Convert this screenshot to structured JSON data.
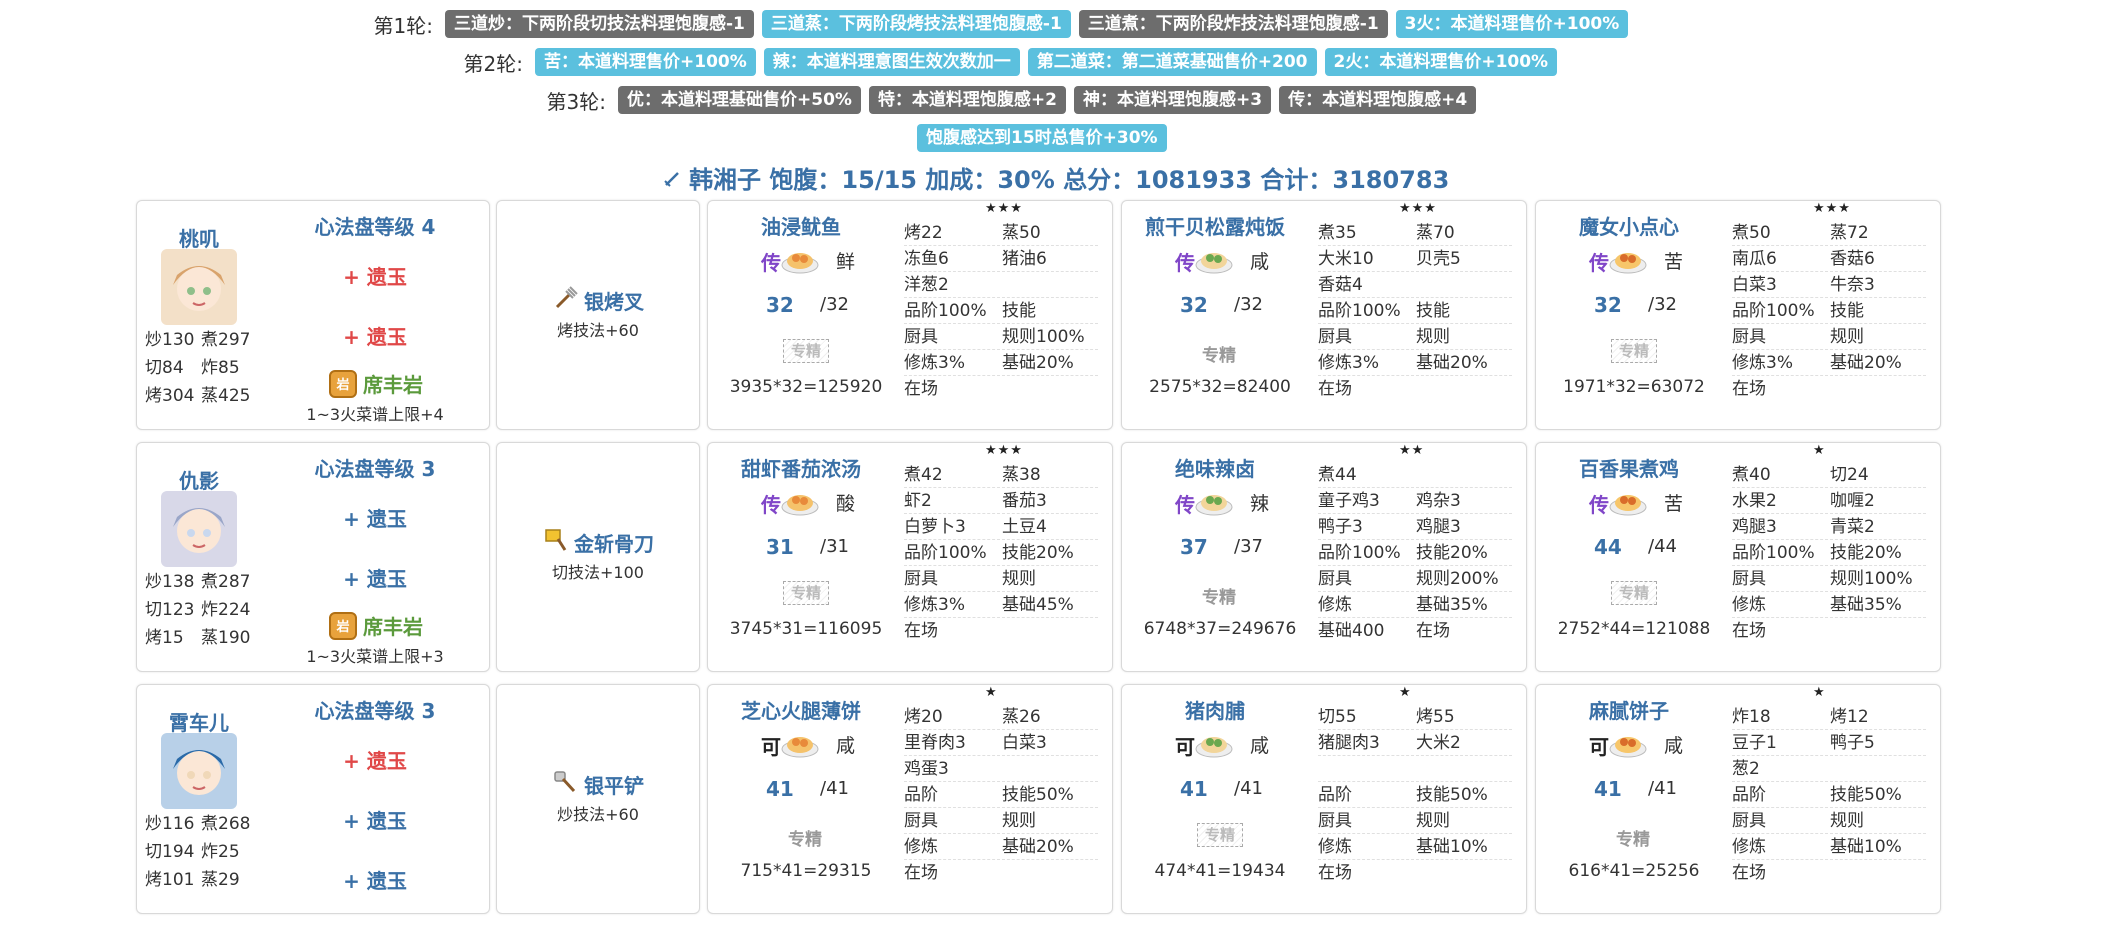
{
  "rounds": [
    {
      "label": "第1轮:",
      "tags": [
        {
          "text": "三道炒：下两阶段切技法料理饱腹感-1",
          "color": "gray"
        },
        {
          "text": "三道蒸：下两阶段烤技法料理饱腹感-1",
          "color": "blue"
        },
        {
          "text": "三道煮：下两阶段炸技法料理饱腹感-1",
          "color": "gray"
        },
        {
          "text": "3火：本道料理售价+100%",
          "color": "blue"
        }
      ]
    },
    {
      "label": "第2轮:",
      "tags": [
        {
          "text": "苦：本道料理售价+100%",
          "color": "blue"
        },
        {
          "text": "辣：本道料理意图生效次数加一",
          "color": "blue"
        },
        {
          "text": "第二道菜：第二道菜基础售价+200",
          "color": "blue"
        },
        {
          "text": "2火：本道料理售价+100%",
          "color": "blue"
        }
      ]
    },
    {
      "label": "第3轮:",
      "tags": [
        {
          "text": "优：本道料理基础售价+50%",
          "color": "gray"
        },
        {
          "text": "特：本道料理饱腹感+2",
          "color": "gray"
        },
        {
          "text": "神：本道料理饱腹感+3",
          "color": "gray"
        },
        {
          "text": "传：本道料理饱腹感+4",
          "color": "gray"
        }
      ]
    },
    {
      "label": "",
      "tags": [
        {
          "text": "饱腹感达到15时总售价+30%",
          "color": "blue"
        }
      ]
    }
  ],
  "summary": {
    "icon": "sword-icon",
    "text": "韩湘子 饱腹：15/15 加成：30% 总分：1081933 合计：3180783"
  },
  "colors": {
    "accent": "#3a70a6",
    "tag_gray": "#6d6d6d",
    "tag_blue": "#5bc0de",
    "red": "#e04848",
    "green": "#5b9a3c",
    "purple": "#8046c8"
  },
  "rows": [
    {
      "chef": {
        "name": "桃叽",
        "heart_level": "心法盘等级 4",
        "remains": [
          {
            "text": "+ 遗玉",
            "color": "red"
          },
          {
            "text": "+ 遗玉",
            "color": "red"
          }
        ],
        "partner": "席丰岩",
        "partner_skill": "1~3火菜谱上限+4",
        "stats": [
          [
            "炒130",
            "煮297"
          ],
          [
            "切84",
            "炸85"
          ],
          [
            "烤304",
            "蒸425"
          ]
        ]
      },
      "equip": {
        "name": "银烤叉",
        "skill": "烤技法+60",
        "icon": "fork-icon"
      },
      "dishes": [
        {
          "name": "油浸鱿鱼",
          "stars": "★★★",
          "rarity": "传",
          "rarity_color": "purple",
          "flavor": "鲜",
          "qty": "32",
          "max": "/32",
          "spec": "专精",
          "spec_style": "box",
          "score": "3935*32=125920",
          "cells": [
            [
              "烤22",
              "蒸50"
            ],
            [
              "冻鱼6",
              "猪油6"
            ],
            [
              "洋葱2",
              ""
            ],
            [
              "品阶100%",
              "技能"
            ],
            [
              "厨具",
              "规则100%"
            ],
            [
              "修炼3%",
              "基础20%"
            ],
            [
              "在场",
              ""
            ]
          ]
        },
        {
          "name": "煎干贝松露炖饭",
          "stars": "★★★",
          "rarity": "传",
          "rarity_color": "purple",
          "flavor": "咸",
          "qty": "32",
          "max": "/32",
          "spec": "专精",
          "spec_style": "text",
          "score": "2575*32=82400",
          "cells": [
            [
              "煮35",
              "蒸70"
            ],
            [
              "大米10",
              "贝壳5"
            ],
            [
              "香菇4",
              ""
            ],
            [
              "品阶100%",
              "技能"
            ],
            [
              "厨具",
              "规则"
            ],
            [
              "修炼3%",
              "基础20%"
            ],
            [
              "在场",
              ""
            ]
          ]
        },
        {
          "name": "魔女小点心",
          "stars": "★★★",
          "rarity": "传",
          "rarity_color": "purple",
          "flavor": "苦",
          "qty": "32",
          "max": "/32",
          "spec": "专精",
          "spec_style": "box",
          "score": "1971*32=63072",
          "cells": [
            [
              "煮50",
              "蒸72"
            ],
            [
              "南瓜6",
              "香菇6"
            ],
            [
              "白菜3",
              "牛奈3"
            ],
            [
              "品阶100%",
              "技能"
            ],
            [
              "厨具",
              "规则"
            ],
            [
              "修炼3%",
              "基础20%"
            ],
            [
              "在场",
              ""
            ]
          ]
        }
      ]
    },
    {
      "chef": {
        "name": "仇影",
        "heart_level": "心法盘等级 3",
        "remains": [
          {
            "text": "+ 遗玉",
            "color": "blue"
          },
          {
            "text": "+ 遗玉",
            "color": "blue"
          }
        ],
        "partner": "席丰岩",
        "partner_skill": "1~3火菜谱上限+3",
        "stats": [
          [
            "炒138",
            "煮287"
          ],
          [
            "切123",
            "炸224"
          ],
          [
            "烤15",
            "蒸190"
          ]
        ]
      },
      "equip": {
        "name": "金斩骨刀",
        "skill": "切技法+100",
        "icon": "cleaver-icon"
      },
      "dishes": [
        {
          "name": "甜虾番茄浓汤",
          "stars": "★★★",
          "rarity": "传",
          "rarity_color": "purple",
          "flavor": "酸",
          "qty": "31",
          "max": "/31",
          "spec": "专精",
          "spec_style": "box",
          "score": "3745*31=116095",
          "cells": [
            [
              "煮42",
              "蒸38"
            ],
            [
              "虾2",
              "番茄3"
            ],
            [
              "白萝卜3",
              "土豆4"
            ],
            [
              "品阶100%",
              "技能20%"
            ],
            [
              "厨具",
              "规则"
            ],
            [
              "修炼3%",
              "基础45%"
            ],
            [
              "在场",
              ""
            ]
          ]
        },
        {
          "name": "绝味辣卤",
          "stars": "★★",
          "rarity": "传",
          "rarity_color": "purple",
          "flavor": "辣",
          "qty": "37",
          "max": "/37",
          "spec": "专精",
          "spec_style": "text",
          "score": "6748*37=249676",
          "cells": [
            [
              "煮44",
              ""
            ],
            [
              "童子鸡3",
              "鸡杂3"
            ],
            [
              "鸭子3",
              "鸡腿3"
            ],
            [
              "品阶100%",
              "技能20%"
            ],
            [
              "厨具",
              "规则200%"
            ],
            [
              "修炼",
              "基础35%"
            ],
            [
              "基础400",
              "在场"
            ]
          ]
        },
        {
          "name": "百香果煮鸡",
          "stars": "★",
          "rarity": "传",
          "rarity_color": "purple",
          "flavor": "苦",
          "qty": "44",
          "max": "/44",
          "spec": "专精",
          "spec_style": "box",
          "score": "2752*44=121088",
          "cells": [
            [
              "煮40",
              "切24"
            ],
            [
              "水果2",
              "咖喱2"
            ],
            [
              "鸡腿3",
              "青菜2"
            ],
            [
              "品阶100%",
              "技能20%"
            ],
            [
              "厨具",
              "规则100%"
            ],
            [
              "修炼",
              "基础35%"
            ],
            [
              "在场",
              ""
            ]
          ]
        }
      ]
    },
    {
      "chef": {
        "name": "霄车儿",
        "heart_level": "心法盘等级 3",
        "remains": [
          {
            "text": "+ 遗玉",
            "color": "red"
          },
          {
            "text": "+ 遗玉",
            "color": "blue"
          },
          {
            "text": "+ 遗玉",
            "color": "blue"
          }
        ],
        "partner": "",
        "partner_skill": "",
        "stats": [
          [
            "炒116",
            "煮268"
          ],
          [
            "切194",
            "炸25"
          ],
          [
            "烤101",
            "蒸29"
          ]
        ]
      },
      "equip": {
        "name": "银平铲",
        "skill": "炒技法+60",
        "icon": "spatula-icon"
      },
      "dishes": [
        {
          "name": "芝心火腿薄饼",
          "stars": "★",
          "rarity": "可",
          "rarity_color": "black",
          "flavor": "咸",
          "qty": "41",
          "max": "/41",
          "spec": "专精",
          "spec_style": "text",
          "score": "715*41=29315",
          "cells": [
            [
              "烤20",
              "蒸26"
            ],
            [
              "里脊肉3",
              "白菜3"
            ],
            [
              "鸡蛋3",
              ""
            ],
            [
              "品阶",
              "技能50%"
            ],
            [
              "厨具",
              "规则"
            ],
            [
              "修炼",
              "基础20%"
            ],
            [
              "在场",
              ""
            ]
          ]
        },
        {
          "name": "猪肉脯",
          "stars": "★",
          "rarity": "可",
          "rarity_color": "black",
          "flavor": "咸",
          "qty": "41",
          "max": "/41",
          "spec": "专精",
          "spec_style": "box",
          "score": "474*41=19434",
          "cells": [
            [
              "切55",
              "烤55"
            ],
            [
              "猪腿肉3",
              "大米2"
            ],
            [
              "",
              ""
            ],
            [
              "品阶",
              "技能50%"
            ],
            [
              "厨具",
              "规则"
            ],
            [
              "修炼",
              "基础10%"
            ],
            [
              "在场",
              ""
            ]
          ]
        },
        {
          "name": "麻腻饼子",
          "stars": "★",
          "rarity": "可",
          "rarity_color": "black",
          "flavor": "咸",
          "qty": "41",
          "max": "/41",
          "spec": "专精",
          "spec_style": "text",
          "score": "616*41=25256",
          "cells": [
            [
              "炸18",
              "烤12"
            ],
            [
              "豆子1",
              "鸭子5"
            ],
            [
              "葱2",
              ""
            ],
            [
              "品阶",
              "技能50%"
            ],
            [
              "厨具",
              "规则"
            ],
            [
              "修炼",
              "基础10%"
            ],
            [
              "在场",
              ""
            ]
          ]
        }
      ]
    }
  ]
}
